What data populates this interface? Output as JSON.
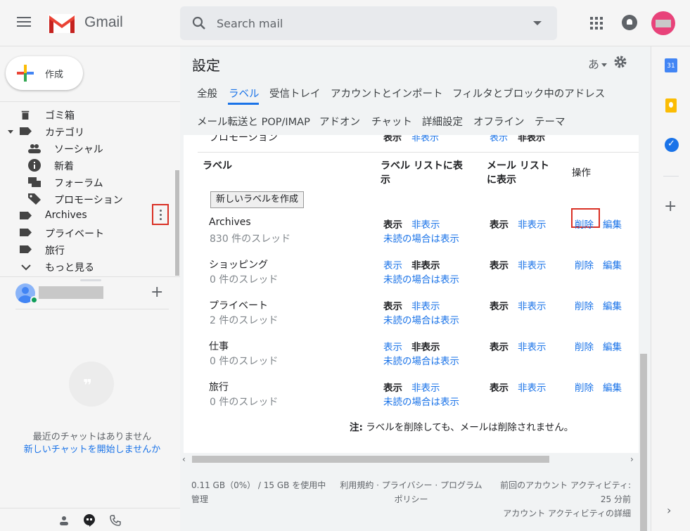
{
  "header": {
    "brand": "Gmail",
    "search_placeholder": "Search mail"
  },
  "sidebar": {
    "compose_label": "作成",
    "items": [
      {
        "label": "ゴミ箱"
      },
      {
        "label": "カテゴリ"
      },
      {
        "label": "ソーシャル"
      },
      {
        "label": "新着"
      },
      {
        "label": "フォーラム"
      },
      {
        "label": "プロモーション"
      },
      {
        "label": "Archives"
      },
      {
        "label": "プライベート"
      },
      {
        "label": "旅行"
      },
      {
        "label": "もっと見る"
      }
    ],
    "no_chats": "最近のチャットはありません",
    "start_chat": "新しいチャットを開始しませんか"
  },
  "main": {
    "title": "設定",
    "lang": "あ",
    "tabs_row1": [
      "全般",
      "ラベル",
      "受信トレイ",
      "アカウントとインポート",
      "フィルタとブロック中のアドレス"
    ],
    "tabs_row2": [
      "メール転送と POP/IMAP",
      "アドオン",
      "チャット",
      "詳細設定",
      "オフライン",
      "テーマ"
    ],
    "clipped_row": {
      "name": "プロモーション",
      "show": "表示",
      "hide": "非表示"
    },
    "columns": {
      "label": "ラベル",
      "label_list_1": "ラベル リストに表",
      "label_list_2": "示",
      "mail_list_1": "メール リスト",
      "mail_list_2": "に表示",
      "actions": "操作"
    },
    "new_label_button": "新しいラベルを作成",
    "labels": [
      {
        "name": "Archives",
        "count": "830 件のスレッド",
        "ll_bold": "show"
      },
      {
        "name": "ショッピング",
        "count": "0 件のスレッド",
        "ll_bold": "hide"
      },
      {
        "name": "プライベート",
        "count": "2 件のスレッド",
        "ll_bold": "show"
      },
      {
        "name": "仕事",
        "count": "0 件のスレッド",
        "ll_bold": "hide"
      },
      {
        "name": "旅行",
        "count": "0 件のスレッド",
        "ll_bold": "show"
      }
    ],
    "show": "表示",
    "hide": "非表示",
    "show_if_unread": "未読の場合は表示",
    "delete": "削除",
    "edit": "編集",
    "note_prefix": "注:",
    "note_text": " ラベルを削除しても、メールは削除されません。"
  },
  "footer": {
    "usage_1": "0.11 GB（0%） / 15 GB を使用中",
    "usage_2": "管理",
    "terms_1": "利用規約 · プライバシー · プログラム",
    "terms_2": "ポリシー",
    "activity_1": "前回のアカウント アクティビティ:",
    "activity_2": "25 分前",
    "activity_3": "アカウント アクティビティの詳細"
  },
  "rightpanel": {
    "calendar_day": "31"
  }
}
